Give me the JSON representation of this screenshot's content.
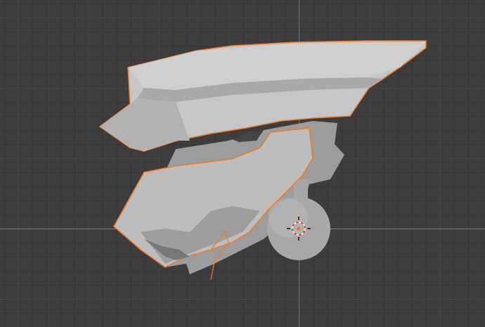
{
  "viewport": {
    "background": "#3d3d3d",
    "x_axis_color": "#6f9a2a",
    "y_axis_color": "#3f6fb0",
    "selection_outline_color": "#f07a22",
    "model_fill": "#b9b9b9",
    "model_shadow": "#8f8f8f",
    "model_highlight": "#d4d4d4"
  },
  "icons": {
    "origin": "3d-cursor-icon"
  }
}
